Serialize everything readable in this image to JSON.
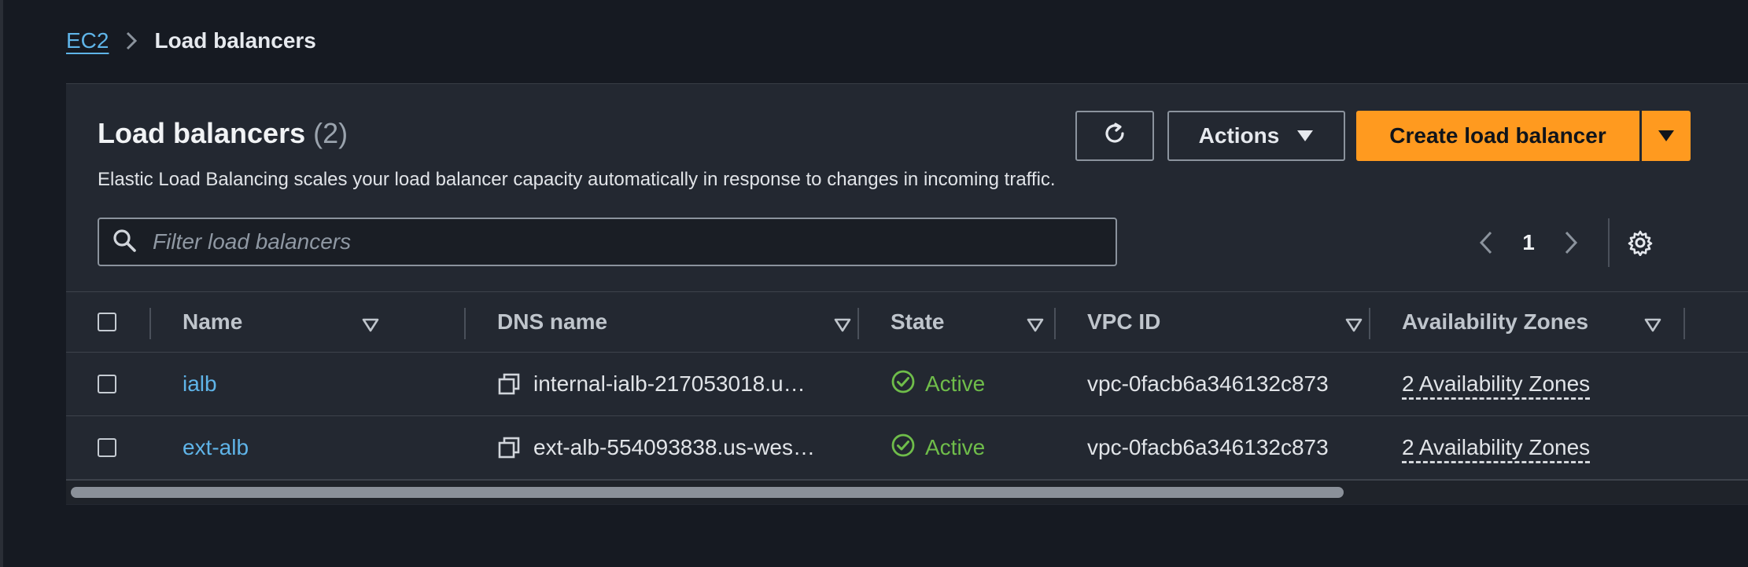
{
  "breadcrumb": {
    "parent": "EC2",
    "current": "Load balancers"
  },
  "panel": {
    "title": "Load balancers",
    "count": "(2)",
    "description": "Elastic Load Balancing scales your load balancer capacity automatically in response to changes in incoming traffic."
  },
  "toolbar": {
    "actions_label": "Actions",
    "create_label": "Create load balancer",
    "accent_color": "#ff9a1f"
  },
  "search": {
    "placeholder": "Filter load balancers",
    "value": ""
  },
  "pagination": {
    "current_page": "1"
  },
  "table": {
    "columns": [
      "Name",
      "DNS name",
      "State",
      "VPC ID",
      "Availability Zones"
    ],
    "rows": [
      {
        "name": "ialb",
        "dns": "internal-ialb-217053018.u…",
        "state": "Active",
        "vpc": "vpc-0facb6a346132c873",
        "az": "2 Availability Zones"
      },
      {
        "name": "ext-alb",
        "dns": "ext-alb-554093838.us-wes…",
        "state": "Active",
        "vpc": "vpc-0facb6a346132c873",
        "az": "2 Availability Zones"
      }
    ]
  },
  "icons": {
    "refresh": "refresh-icon",
    "actions_caret": "caret-down-icon",
    "search": "search-icon",
    "settings": "gear-icon",
    "copy": "copy-icon",
    "status_ok": "check-circle-icon"
  }
}
